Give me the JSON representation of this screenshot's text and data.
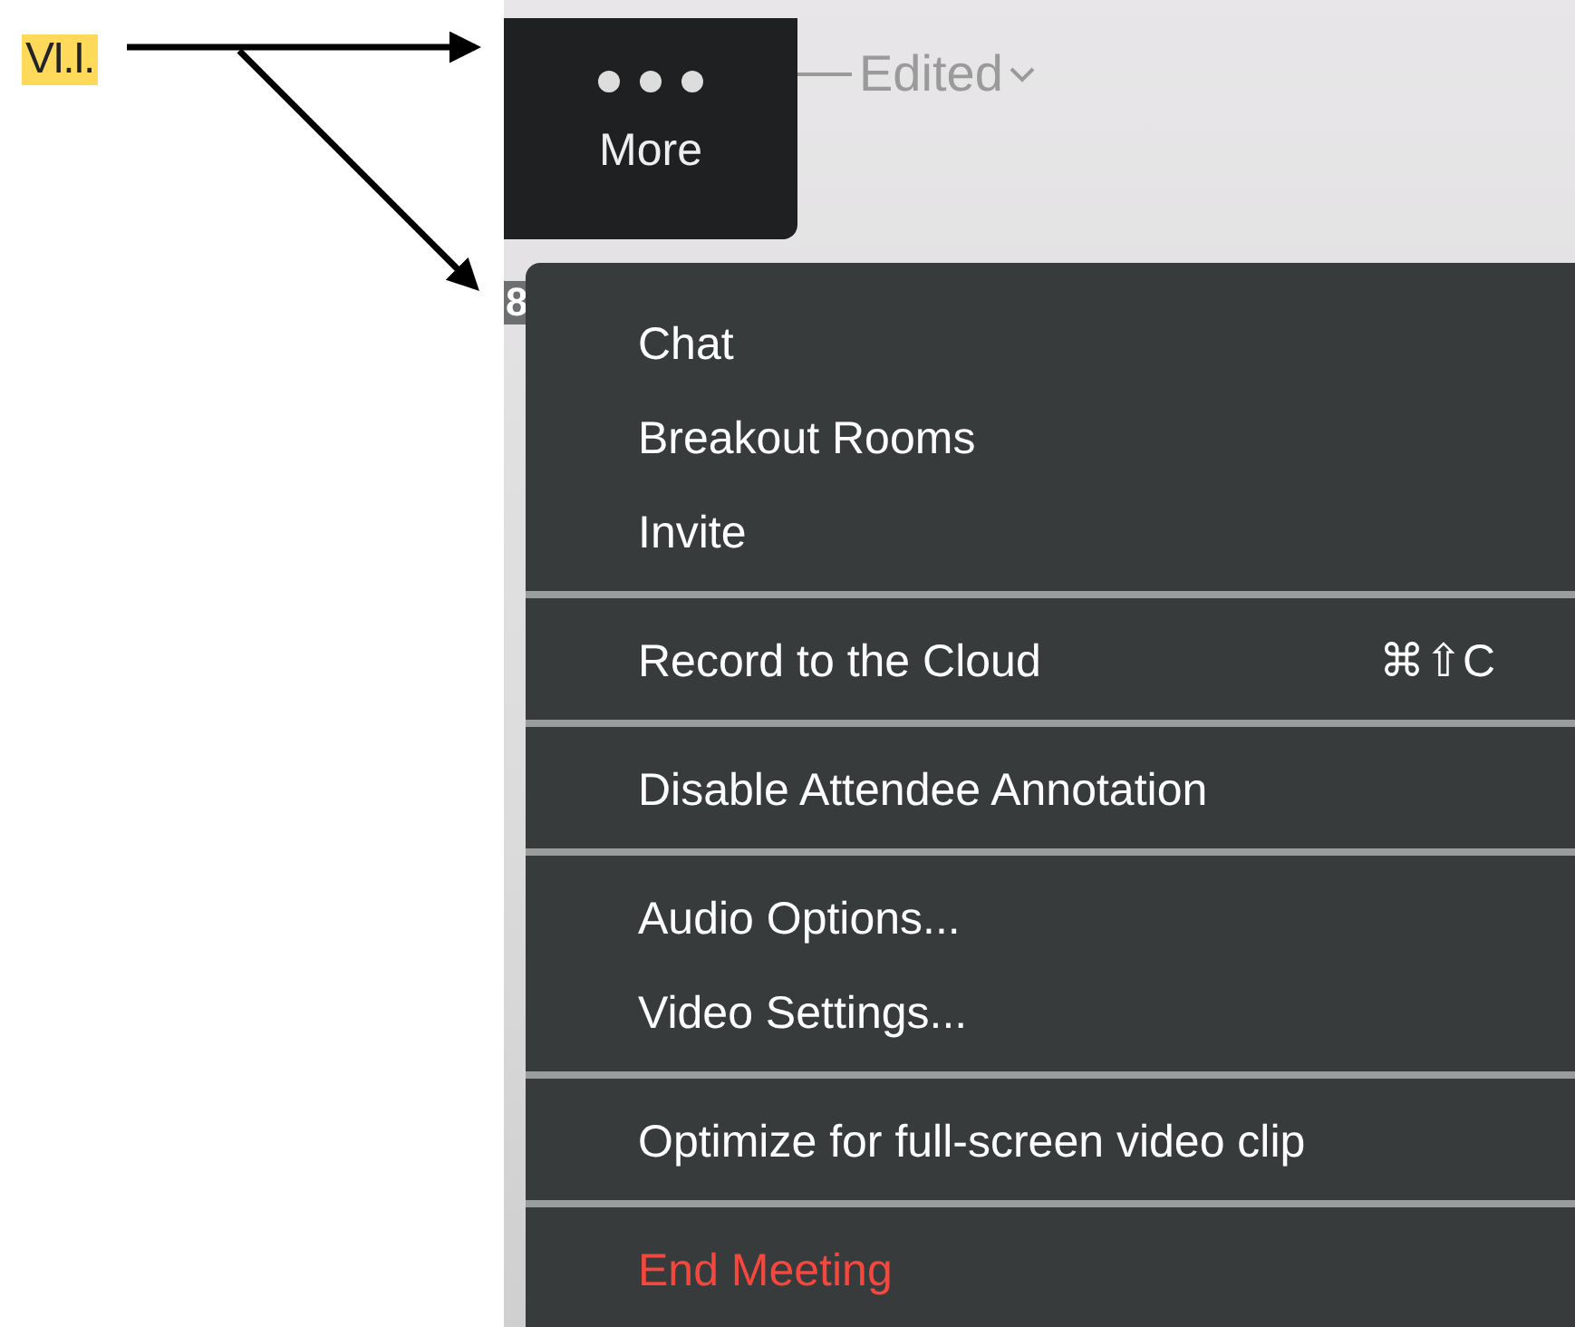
{
  "annotation": {
    "label": "VI.I."
  },
  "toolbar": {
    "more_button": {
      "label": "More"
    },
    "status": {
      "label": "Edited"
    }
  },
  "behind_menu": {
    "badge": "8"
  },
  "menu": [
    {
      "kind": "item",
      "label": "Chat",
      "danger": false
    },
    {
      "kind": "item",
      "label": "Breakout Rooms",
      "danger": false
    },
    {
      "kind": "item",
      "label": "Invite",
      "danger": false
    },
    {
      "kind": "separator"
    },
    {
      "kind": "item",
      "label": "Record to the Cloud",
      "shortcut": "⌘⇧C",
      "danger": false
    },
    {
      "kind": "separator"
    },
    {
      "kind": "item",
      "label": "Disable Attendee Annotation",
      "danger": false
    },
    {
      "kind": "separator"
    },
    {
      "kind": "item",
      "label": "Audio Options...",
      "danger": false
    },
    {
      "kind": "item",
      "label": "Video Settings...",
      "danger": false
    },
    {
      "kind": "separator"
    },
    {
      "kind": "item",
      "label": "Optimize for full-screen video clip",
      "danger": false
    },
    {
      "kind": "separator"
    },
    {
      "kind": "item",
      "label": "End Meeting",
      "danger": true
    }
  ]
}
